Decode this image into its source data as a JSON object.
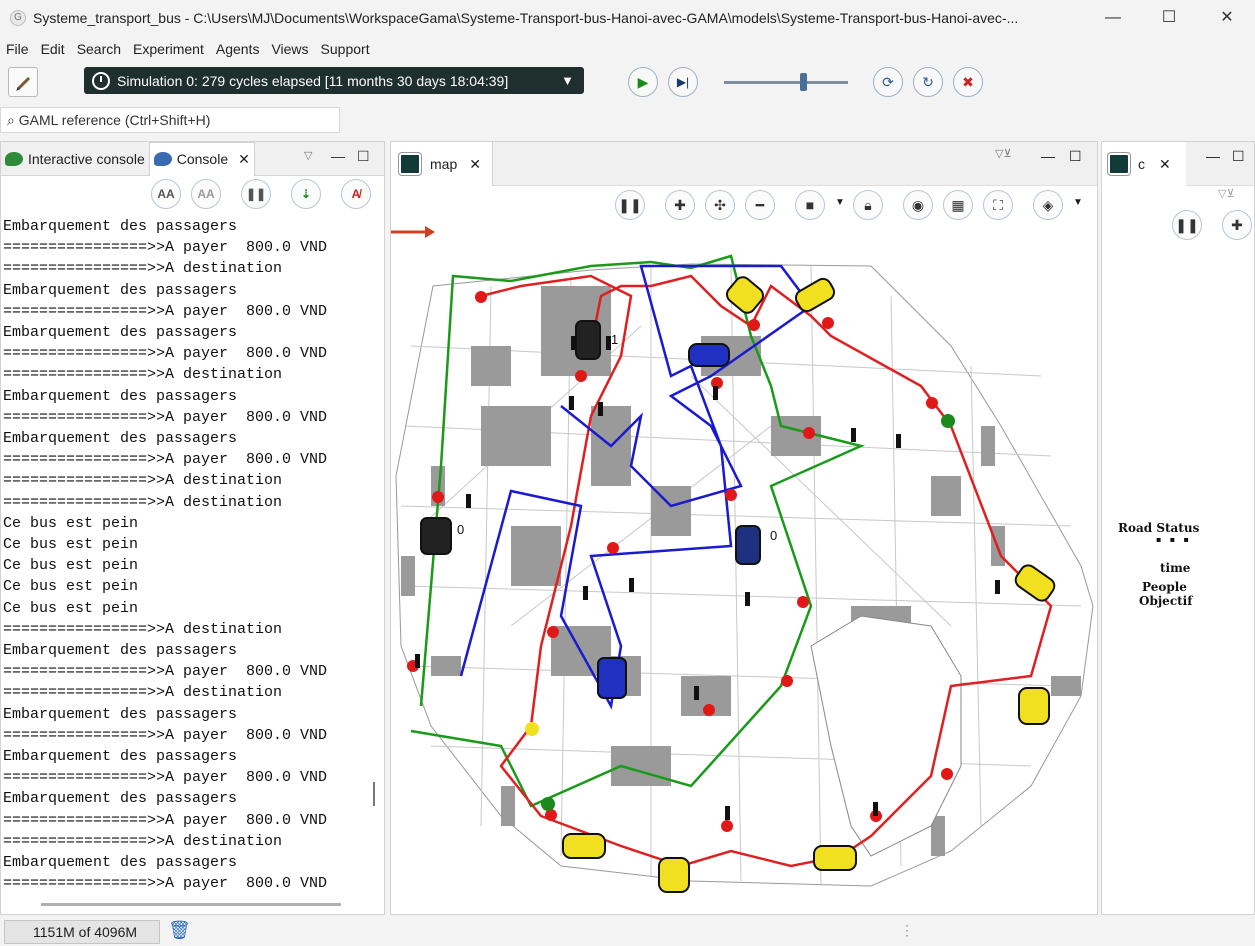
{
  "window": {
    "title": "Systeme_transport_bus - C:\\Users\\MJ\\Documents\\WorkspaceGama\\Systeme-Transport-bus-Hanoi-avec-GAMA\\models\\Systeme-Transport-bus-Hanoi-avec-...",
    "minimize": "—",
    "maximize": "☐",
    "close": "✕"
  },
  "menu": [
    "File",
    "Edit",
    "Search",
    "Experiment",
    "Agents",
    "Views",
    "Support"
  ],
  "toolbar": {
    "simulation_status": "Simulation 0: 279 cycles elapsed [11 months 30 days 18:04:39]",
    "slider_level": 0.63
  },
  "search": {
    "label": "GAML reference (Ctrl+Shift+H)"
  },
  "left_panel": {
    "tabs": [
      {
        "label": "Interactive console"
      },
      {
        "label": "Console"
      }
    ],
    "console_lines": [
      "Embarquement des passagers",
      "================>>A payer  800.0 VND",
      "================>>A destination",
      "Embarquement des passagers",
      "================>>A payer  800.0 VND",
      "Embarquement des passagers",
      "================>>A payer  800.0 VND",
      "================>>A destination",
      "Embarquement des passagers",
      "================>>A payer  800.0 VND",
      "Embarquement des passagers",
      "================>>A payer  800.0 VND",
      "================>>A destination",
      "================>>A destination",
      "Ce bus est pein",
      "Ce bus est pein",
      "Ce bus est pein",
      "Ce bus est pein",
      "Ce bus est pein",
      "================>>A destination",
      "Embarquement des passagers",
      "================>>A payer  800.0 VND",
      "================>>A destination",
      "Embarquement des passagers",
      "================>>A payer  800.0 VND",
      "Embarquement des passagers",
      "================>>A payer  800.0 VND",
      "Embarquement des passagers",
      "================>>A payer  800.0 VND",
      "================>>A destination",
      "Embarquement des passagers",
      "================>>A payer  800.0 VND"
    ]
  },
  "map_panel": {
    "tab_label": "map",
    "map_labels": {
      "zero_a": "0",
      "zero_b": "0",
      "one": "1"
    }
  },
  "right_panel": {
    "tab_label": "c",
    "legend": [
      "Road Status",
      "time",
      "People",
      "Objectif"
    ]
  },
  "status": {
    "memory": "1151M of 4096M"
  },
  "colors": {
    "sim_status_bg": "#1e2f2d",
    "route_red": "#e02020",
    "route_green": "#1a9a1a",
    "route_blue": "#1a1ad0"
  }
}
